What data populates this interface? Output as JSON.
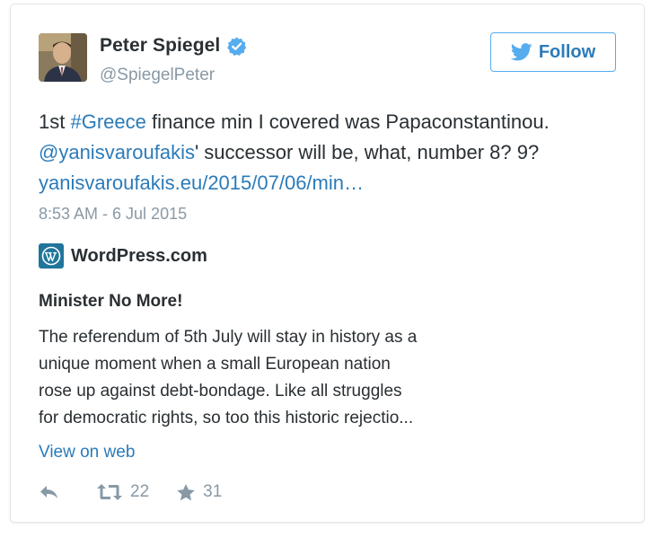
{
  "author": {
    "name": "Peter Spiegel",
    "handle": "@SpiegelPeter",
    "verified": true
  },
  "follow_button": {
    "label": "Follow"
  },
  "tweet": {
    "part1": "1st ",
    "hashtag": "#Greece",
    "part2": " finance min I covered was Papaconstantinou.",
    "mention": "@yanisvaroufakis",
    "part3": "' successor will be, what, number 8? 9?",
    "link": "yanisvaroufakis.eu/2015/07/06/min…"
  },
  "timestamp": "8:53 AM - 6 Jul 2015",
  "card": {
    "site_name": "WordPress.com",
    "title": "Minister No More!",
    "description_lines": [
      "The referendum of 5th July will stay in history as a",
      "unique moment when a small European nation",
      "rose up against debt-bondage. Like all struggles",
      "for democratic rights, so too this historic rejectio..."
    ],
    "view_link": "View on web"
  },
  "actions": {
    "retweets": "22",
    "favorites": "31"
  },
  "colors": {
    "link": "#2b7bb9",
    "muted": "#8899a6",
    "border": "#e1e8ed",
    "follow_border": "#55acee",
    "wordpress": "#21759b"
  },
  "icons": [
    "verified-icon",
    "twitter-bird-icon",
    "wordpress-icon",
    "reply-icon",
    "retweet-icon",
    "star-icon"
  ]
}
